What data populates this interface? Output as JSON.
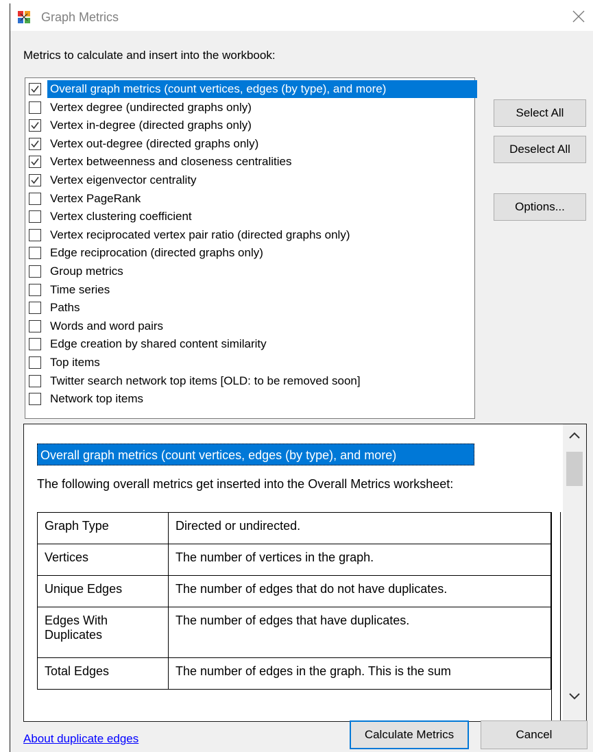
{
  "window": {
    "title": "Graph Metrics"
  },
  "metrics_label": "Metrics to calculate and insert into the workbook:",
  "metrics": [
    {
      "label": "Overall graph metrics (count vertices, edges (by type), and more)",
      "checked": true,
      "selected": true
    },
    {
      "label": "Vertex degree (undirected graphs only)",
      "checked": false,
      "selected": false
    },
    {
      "label": "Vertex in-degree (directed graphs only)",
      "checked": true,
      "selected": false
    },
    {
      "label": "Vertex out-degree (directed graphs only)",
      "checked": true,
      "selected": false
    },
    {
      "label": "Vertex betweenness and closeness centralities",
      "checked": true,
      "selected": false
    },
    {
      "label": "Vertex eigenvector centrality",
      "checked": true,
      "selected": false
    },
    {
      "label": "Vertex PageRank",
      "checked": false,
      "selected": false
    },
    {
      "label": "Vertex clustering coefficient",
      "checked": false,
      "selected": false
    },
    {
      "label": "Vertex reciprocated vertex pair ratio (directed graphs only)",
      "checked": false,
      "selected": false
    },
    {
      "label": "Edge reciprocation (directed graphs only)",
      "checked": false,
      "selected": false
    },
    {
      "label": "Group metrics",
      "checked": false,
      "selected": false
    },
    {
      "label": "Time series",
      "checked": false,
      "selected": false
    },
    {
      "label": "Paths",
      "checked": false,
      "selected": false
    },
    {
      "label": "Words and word pairs",
      "checked": false,
      "selected": false
    },
    {
      "label": "Edge creation by shared content similarity",
      "checked": false,
      "selected": false
    },
    {
      "label": "Top items",
      "checked": false,
      "selected": false
    },
    {
      "label": "Twitter search network top items [OLD: to be removed soon]",
      "checked": false,
      "selected": false
    },
    {
      "label": "Network top items",
      "checked": false,
      "selected": false
    }
  ],
  "buttons": {
    "select_all": "Select All",
    "deselect_all": "Deselect All",
    "options": "Options...",
    "calculate": "Calculate Metrics",
    "cancel": "Cancel"
  },
  "description": {
    "heading": "Overall graph metrics (count vertices, edges (by type), and more)",
    "intro": "The following overall metrics get inserted into the Overall Metrics worksheet:",
    "rows": [
      {
        "name": "Graph Type",
        "desc": "Directed or undirected."
      },
      {
        "name": "Vertices",
        "desc": "The number of vertices in the graph."
      },
      {
        "name": "Unique Edges",
        "desc": "The number of edges that do not have duplicates."
      },
      {
        "name": "Edges With Duplicates",
        "desc": "The number of edges that have duplicates."
      },
      {
        "name": "Total Edges",
        "desc": "The number of edges in the graph. This is the sum"
      }
    ]
  },
  "about_link": "About duplicate edges",
  "colors": {
    "selection": "#0078d7",
    "link": "#0000ff",
    "window_bg": "#f0f0f0"
  }
}
